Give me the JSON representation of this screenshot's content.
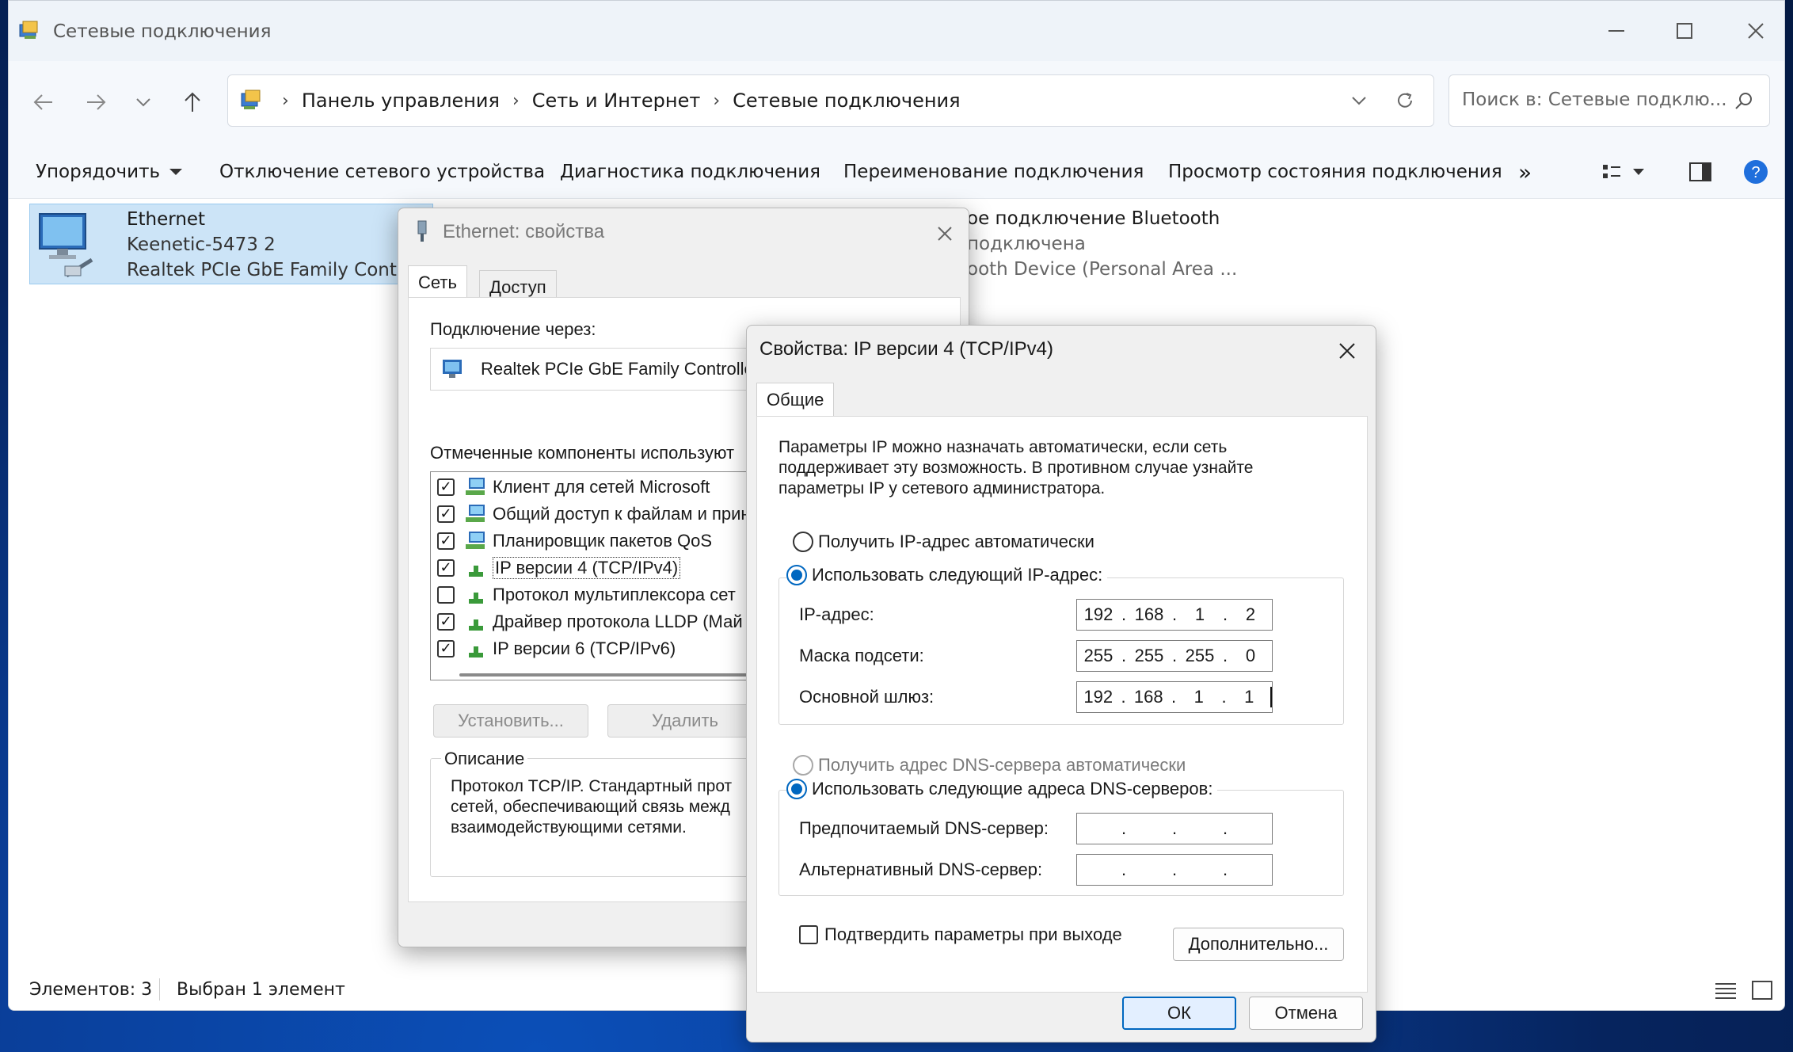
{
  "explorer": {
    "title": "Сетевые подключения",
    "breadcrumb": [
      "Панель управления",
      "Сеть и Интернет",
      "Сетевые подключения"
    ],
    "search_placeholder": "Поиск в: Сетевые подклю...",
    "commands": {
      "organize": "Упорядочить",
      "disable": "Отключение сетевого устройства",
      "diagnose": "Диагностика подключения",
      "rename": "Переименование подключения",
      "status": "Просмотр состояния подключения",
      "more": "»"
    },
    "items": [
      {
        "name": "Ethernet",
        "line2": "Keenetic-5473 2",
        "line3": "Realtek PCIe GbE Family Controlle"
      },
      {
        "name": "ое подключение Bluetooth",
        "line2": "подключена",
        "line3": "ooth Device (Personal Area ..."
      }
    ],
    "status": {
      "count": "Элементов: 3",
      "selected": "Выбран 1 элемент"
    }
  },
  "eth_dialog": {
    "title": "Ethernet: свойства",
    "tabs": [
      "Сеть",
      "Доступ"
    ],
    "connect_via_label": "Подключение через:",
    "adapter": "Realtek PCIe GbE Family Controller",
    "components_label": "Отмеченные компоненты используют",
    "components": [
      {
        "label": "Клиент для сетей Microsoft",
        "checked": true
      },
      {
        "label": "Общий доступ к файлам и прин",
        "checked": true
      },
      {
        "label": "Планировщик пакетов QoS",
        "checked": true
      },
      {
        "label": "IP версии 4 (TCP/IPv4)",
        "checked": true
      },
      {
        "label": "Протокол мультиплексора сет",
        "checked": false
      },
      {
        "label": "Драйвер протокола LLDP (Май",
        "checked": true
      },
      {
        "label": "IP версии 6 (TCP/IPv6)",
        "checked": true
      }
    ],
    "install_btn": "Установить...",
    "remove_btn": "Удалить",
    "description_label": "Описание",
    "description": [
      "Протокол TCP/IP. Стандартный прот",
      "сетей, обеспечивающий связь межд",
      "взаимодействующими сетями."
    ]
  },
  "ipv4_dialog": {
    "title": "Свойства: IP версии 4 (TCP/IPv4)",
    "tab": "Общие",
    "intro": [
      "Параметры IP можно назначать автоматически, если сеть",
      "поддерживает эту возможность. В противном случае узнайте",
      "параметры IP у сетевого администратора."
    ],
    "auto_ip": "Получить IP-адрес автоматически",
    "manual_ip": "Использовать следующий IP-адрес:",
    "ip_label": "IP-адрес:",
    "ip": [
      "192",
      "168",
      "1",
      "2"
    ],
    "mask_label": "Маска подсети:",
    "mask": [
      "255",
      "255",
      "255",
      "0"
    ],
    "gateway_label": "Основной шлюз:",
    "gateway": [
      "192",
      "168",
      "1",
      "1"
    ],
    "auto_dns": "Получить адрес DNS-сервера автоматически",
    "manual_dns": "Использовать следующие адреса DNS-серверов:",
    "pref_dns_label": "Предпочитаемый DNS-сервер:",
    "alt_dns_label": "Альтернативный DNS-сервер:",
    "validate": "Подтвердить параметры при выходе",
    "advanced_btn": "Дополнительно...",
    "ok_btn": "ОК",
    "cancel_btn": "Отмена"
  }
}
